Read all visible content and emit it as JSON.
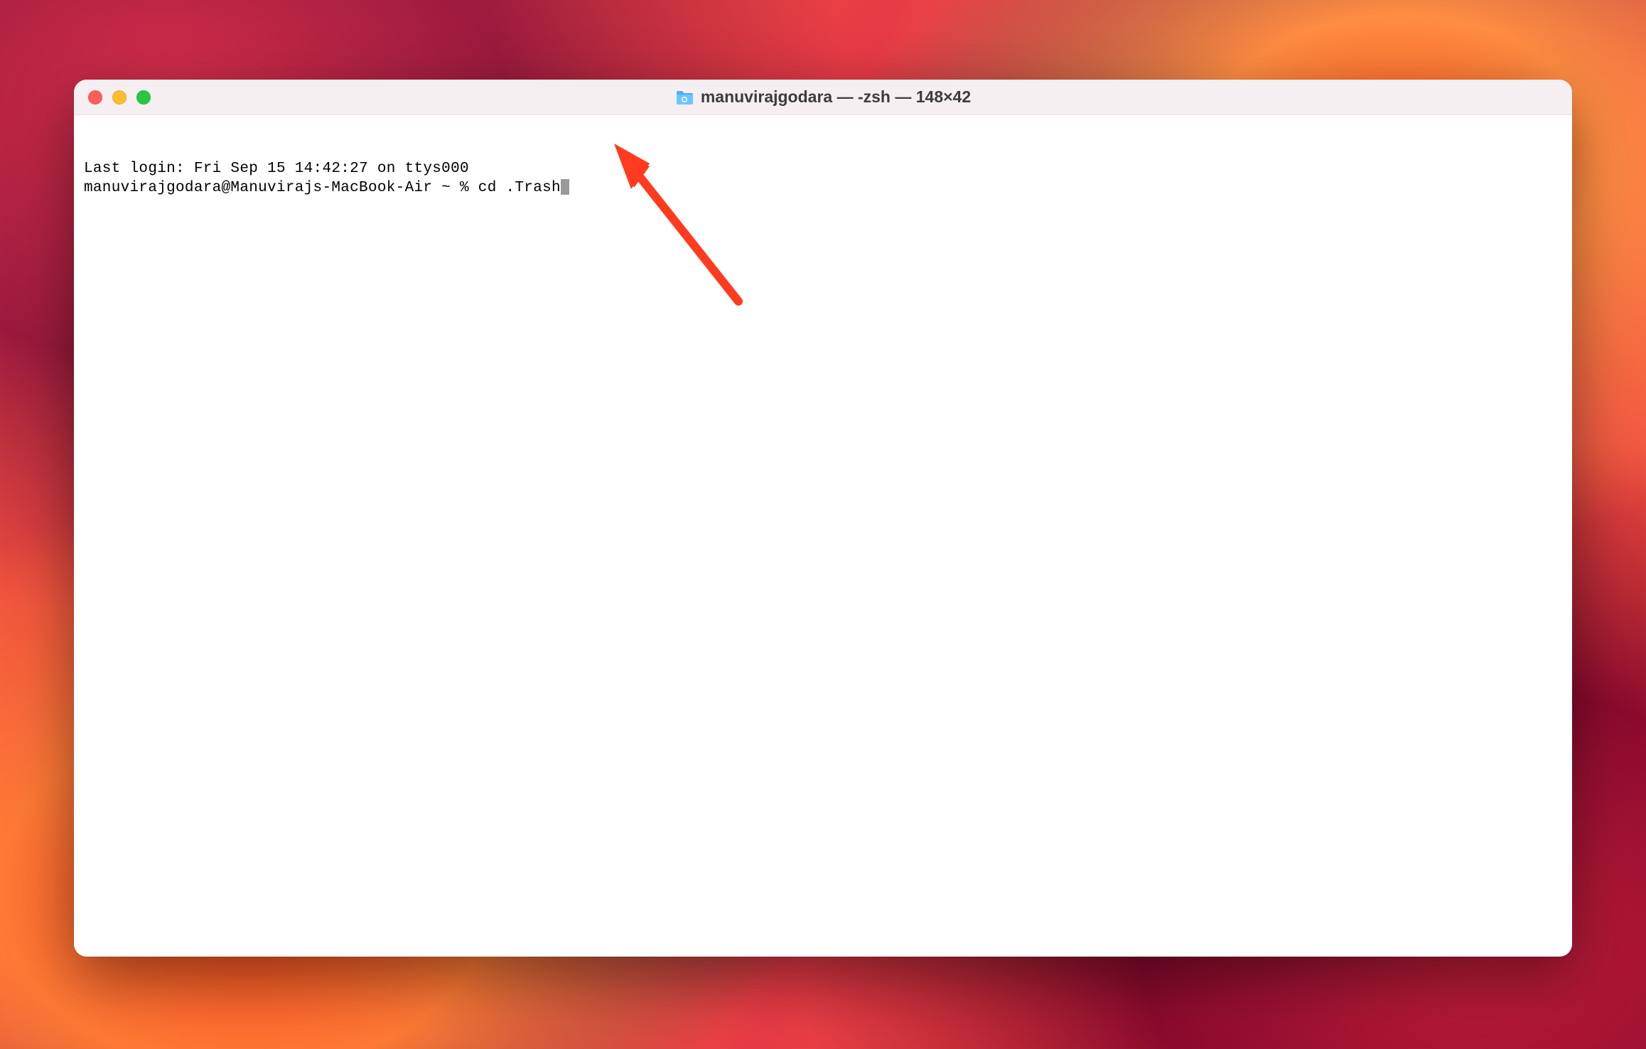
{
  "window": {
    "title": "manuvirajgodara — -zsh — 148×42"
  },
  "terminal": {
    "last_login_line": "Last login: Fri Sep 15 14:42:27 on ttys000",
    "prompt": "manuvirajgodara@Manuvirajs-MacBook-Air ~ % ",
    "command": "cd .Trash"
  },
  "icons": {
    "folder": "folder-icon",
    "close": "close-icon",
    "minimize": "minimize-icon",
    "maximize": "maximize-icon"
  },
  "annotation": {
    "arrow_color": "#ff3b1f"
  }
}
